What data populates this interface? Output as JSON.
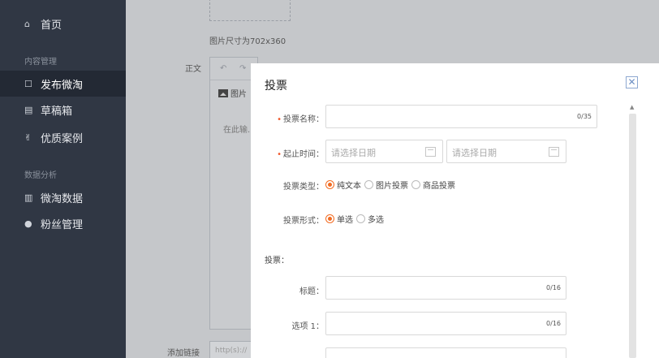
{
  "sidebar": {
    "home": {
      "icon": "home-icon",
      "label": "首页"
    },
    "section_content": "内容管理",
    "items_content": [
      {
        "icon": "edit-icon",
        "label": "发布微淘",
        "active": true
      },
      {
        "icon": "draft-icon",
        "label": "草稿箱"
      },
      {
        "icon": "thumbs-up-icon",
        "label": "优质案例"
      }
    ],
    "section_data": "数据分析",
    "items_data": [
      {
        "icon": "bar-chart-icon",
        "label": "微淘数据"
      },
      {
        "icon": "user-icon",
        "label": "粉丝管理"
      }
    ]
  },
  "editor": {
    "image_size_hint": "图片尺寸为702x360",
    "body_label": "正文",
    "image_button": "图片",
    "placeholder": "在此输..",
    "link_label": "添加链接",
    "link_placeholder": "http(s)://"
  },
  "modal": {
    "title": "投票",
    "close_symbol": "✕",
    "vote_name": {
      "label": "投票名称：",
      "required": true,
      "counter": "0/35"
    },
    "time": {
      "label": "起止时间：",
      "required": true,
      "start_placeholder": "请选择日期",
      "end_placeholder": "请选择日期"
    },
    "vote_type": {
      "label": "投票类型：",
      "options": [
        "纯文本",
        "图片投票",
        "商品投票"
      ],
      "selected": 0
    },
    "vote_form": {
      "label": "投票形式：",
      "options": [
        "单选",
        "多选"
      ],
      "selected": 0
    },
    "vote_section_label": "投票：",
    "title_field": {
      "label": "标题：",
      "counter": "0/16"
    },
    "option1": {
      "label": "选项 1：",
      "counter": "0/16"
    },
    "accent_color": "#f26b21"
  }
}
